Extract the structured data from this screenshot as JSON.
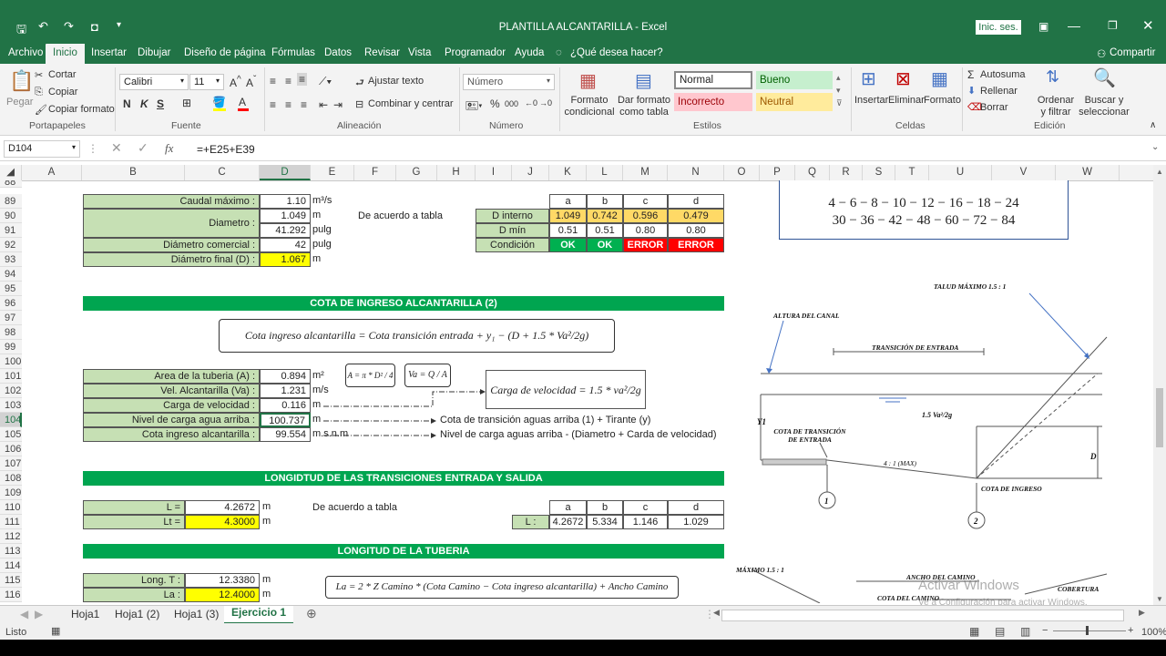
{
  "window": {
    "title": "PLANTILLA ALCANTARILLA  -  Excel",
    "sign_in": "Inic. ses."
  },
  "ribbon_tabs": [
    "Archivo",
    "Inicio",
    "Insertar",
    "Dibujar",
    "Diseño de página",
    "Fórmulas",
    "Datos",
    "Revisar",
    "Vista",
    "Programador",
    "Ayuda"
  ],
  "tell_me": "¿Qué desea hacer?",
  "share": "Compartir",
  "clipboard": {
    "paste": "Pegar",
    "cut": "Cortar",
    "copy": "Copiar",
    "format_painter": "Copiar formato",
    "group": "Portapapeles"
  },
  "font": {
    "name": "Calibri",
    "size": "11",
    "group": "Fuente",
    "bold": "N",
    "italic": "K",
    "underline": "S"
  },
  "alignment": {
    "wrap": "Ajustar texto",
    "merge": "Combinar y centrar",
    "group": "Alineación"
  },
  "number": {
    "format": "Número",
    "group": "Número",
    "percent": "%",
    "thousands": "000"
  },
  "styles": {
    "conditional": "Formato condicional",
    "table": "Dar formato como tabla",
    "normal": "Normal",
    "good": "Bueno",
    "bad": "Incorrecto",
    "neutral": "Neutral",
    "group": "Estilos"
  },
  "cells": {
    "insert": "Insertar",
    "delete": "Eliminar",
    "format": "Formato",
    "group": "Celdas"
  },
  "editing": {
    "autosum": "Autosuma",
    "fill": "Rellenar",
    "clear": "Borrar",
    "sort": "Ordenar y filtrar",
    "find": "Buscar y seleccionar",
    "group": "Edición"
  },
  "formula_bar": {
    "name_box": "D104",
    "formula": "=+E25+E39",
    "fx": "fx"
  },
  "columns": [
    "A",
    "B",
    "C",
    "D",
    "E",
    "F",
    "G",
    "H",
    "I",
    "J",
    "K",
    "L",
    "M",
    "N",
    "O",
    "P",
    "Q",
    "R",
    "S",
    "T",
    "U",
    "V",
    "W"
  ],
  "rows": [
    "88",
    "89",
    "90",
    "91",
    "92",
    "93",
    "94",
    "95",
    "96",
    "97",
    "98",
    "99",
    "100",
    "101",
    "102",
    "103",
    "104",
    "105",
    "106",
    "107",
    "108",
    "109",
    "110",
    "111",
    "112",
    "113",
    "114",
    "115",
    "116"
  ],
  "block1": {
    "caudal_label": "Caudal máximo :",
    "caudal_val": "1.10",
    "caudal_unit": "m³/s",
    "diam_label": "Diametro :",
    "diam_val": "1.049",
    "diam_unit": "m",
    "diam_val2": "41.292",
    "diam_unit2": "pulg",
    "dcom_label": "Diámetro comercial :",
    "dcom_val": "42",
    "dcom_unit": "pulg",
    "dfin_label": "Diámetro final (D) :",
    "dfin_val": "1.067",
    "dfin_unit": "m",
    "note": "De acuerdo a tabla"
  },
  "table1": {
    "headers": [
      "a",
      "b",
      "c",
      "d"
    ],
    "row1_label": "D interno",
    "row1": [
      "1.049",
      "0.742",
      "0.596",
      "0.479"
    ],
    "row2_label": "D mín",
    "row2": [
      "0.51",
      "0.51",
      "0.80",
      "0.80"
    ],
    "row3_label": "Condición",
    "row3": [
      "OK",
      "OK",
      "ERROR",
      "ERROR"
    ]
  },
  "diam_list": {
    "line1": "4  − 6  − 8  − 10  − 12 − 16  −  18  −  24",
    "line2": "30  − 36  − 42  − 48  − 60  − 72  − 84"
  },
  "section2": "COTA DE INGRESO ALCANTARILLA (2)",
  "formula2": "Cota ingreso alcantarilla = Cota transición entrada + y₁ − (D + 1.5 * Va²/2g)",
  "block2": {
    "area_label": "Area de la tuberia (A) :",
    "area_val": "0.894",
    "area_unit": "m²",
    "vel_label": "Vel. Alcantarilla (Va) :",
    "vel_val": "1.231",
    "vel_unit": "m/s",
    "carga_label": "Carga de velocidad :",
    "carga_val": "0.116",
    "carga_unit": "m",
    "nivel_label": "Nivel de carga agua arriba :",
    "nivel_val": "100.737",
    "nivel_unit": "m",
    "cota_label": "Cota ingreso alcantarilla :",
    "cota_val": "99.554",
    "cota_unit": "m.s.n.m",
    "nivel_note": "Cota de transición aguas arriba (1) + Tirante (y)",
    "cota_note": "Nivel de carga aguas arriba - (Diametro + Carda de velocidad)",
    "f_area": "A = π * D² / 4",
    "f_vel": "Va = Q / A",
    "f_carga": "Carga de velocidad = 1.5 * va²/2g"
  },
  "section3": "LONGIDTUD DE LAS TRANSICIONES ENTRADA Y SALIDA",
  "block3": {
    "l_label": "L =",
    "l_val": "4.2672",
    "l_unit": "m",
    "lt_label": "Lt =",
    "lt_val": "4.3000",
    "lt_unit": "m",
    "note": "De acuerdo a tabla"
  },
  "table3": {
    "headers": [
      "a",
      "b",
      "c",
      "d"
    ],
    "label": "L :",
    "vals": [
      "4.2672",
      "5.334",
      "1.146",
      "1.029"
    ]
  },
  "section4": "LONGITUD DE LA TUBERIA",
  "block4": {
    "longt_label": "Long. T :",
    "longt_val": "12.3380",
    "longt_unit": "m",
    "la_label": "La :",
    "la_val": "12.4000",
    "la_unit": "m",
    "formula": "La = 2 * Z Camino * (Cota Camino − Cota ingreso alcantarilla) + Ancho Camino"
  },
  "diagram": {
    "talud": "TALUD MÁXIMO 1.5 : 1",
    "altura": "ALTURA DEL CANAL",
    "transicion": "TRANSICIÓN DE ENTRADA",
    "y1": "Y1",
    "cota_trans": "COTA DE TRANSICIÓN DE ENTRADA",
    "pend": "4 : 1 (MAX)",
    "cota_ing": "COTA DE INGRESO",
    "d": "D",
    "c1": "1",
    "c2": "2",
    "vel": "1.5 Va²/2g",
    "talud2": "MÁXIMO 1.5 : 1",
    "ancho": "ANCHO DEL CAMINO",
    "cota_cam": "COTA DEL CAMINO",
    "cobertura": "COBERTURA"
  },
  "watermark": {
    "line1": "Activar Windows",
    "line2": "Ve a Configuración para activar Windows."
  },
  "sheets": [
    "Hoja1",
    "Hoja1 (2)",
    "Hoja1 (3)",
    "Ejercicio 1"
  ],
  "status": {
    "ready": "Listo",
    "zoom": "100%"
  }
}
